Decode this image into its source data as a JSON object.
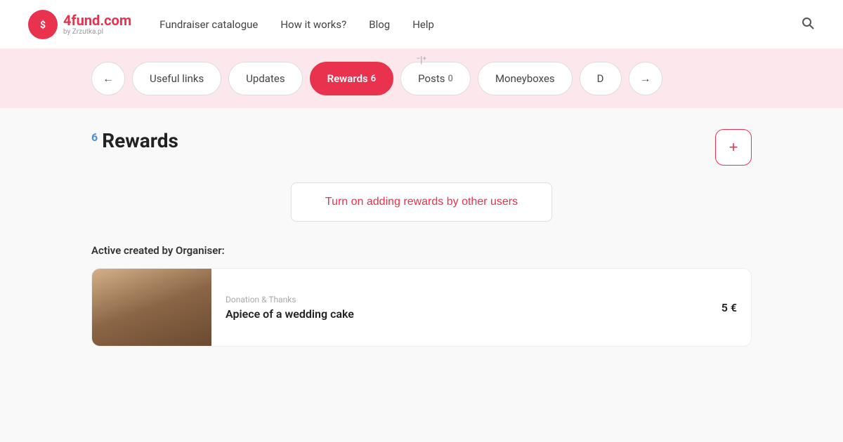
{
  "header": {
    "logo_text": "4fund",
    "logo_dot": ".",
    "logo_com": "com",
    "logo_sub": "by Zrzutka.pl",
    "nav_items": [
      {
        "label": "Fundraiser catalogue"
      },
      {
        "label": "How it works?"
      },
      {
        "label": "Blog"
      },
      {
        "label": "Help"
      }
    ]
  },
  "tabs": {
    "left_arrow": "←",
    "right_arrow": "→",
    "items": [
      {
        "label": "Useful links",
        "badge": null,
        "active": false
      },
      {
        "label": "Updates",
        "badge": null,
        "active": false
      },
      {
        "label": "Rewards",
        "badge": "6",
        "active": true
      },
      {
        "label": "Posts",
        "badge": "0",
        "active": false
      },
      {
        "label": "Moneyboxes",
        "badge": null,
        "active": false
      },
      {
        "label": "D",
        "badge": null,
        "active": false
      }
    ]
  },
  "main": {
    "rewards_title": "Rewards",
    "rewards_count": "6",
    "add_button_label": "+",
    "turn_on_label": "Turn on adding rewards by other users",
    "active_section_label": "Active created by Organiser:",
    "reward_card": {
      "category": "Donation & Thanks",
      "title": "Apiece of a wedding cake",
      "price": "5 €"
    }
  }
}
